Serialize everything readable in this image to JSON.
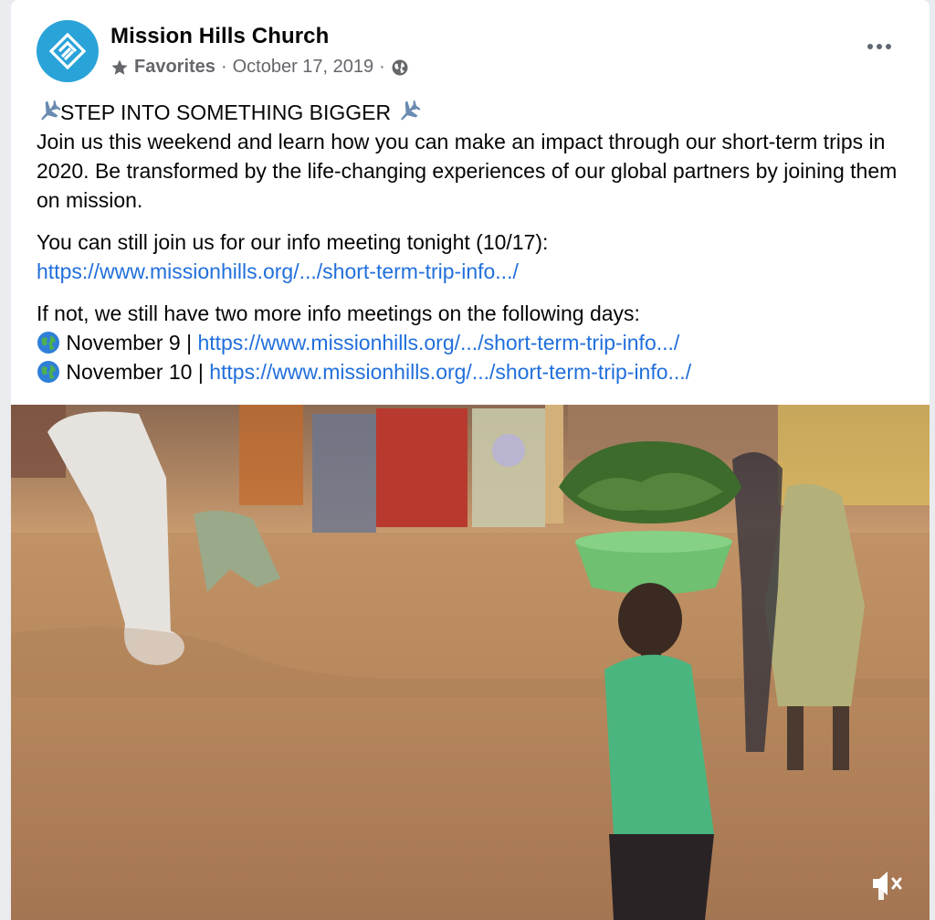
{
  "post": {
    "author": "Mission Hills Church",
    "meta": {
      "star_icon": "star-icon",
      "audience": "Favorites",
      "separator1": "·",
      "date": "October 17, 2019",
      "separator2": "·",
      "privacy_icon": "globe-icon"
    },
    "more_icon": "more-options-icon",
    "headline_icon": "airplane-icon",
    "headline": "STEP INTO SOMETHING BIGGER",
    "paragraph1": "Join us this weekend and learn how you can make an impact through our short-term trips in 2020. Be transformed by the life-changing experiences of our global partners by joining them on mission.",
    "paragraph2": "You can still join us for our info meeting tonight (10/17):",
    "link1": "https://www.missionhills.org/.../short-term-trip-info.../",
    "paragraph3": "If not, we still have two more info meetings on the following days:",
    "meetings": [
      {
        "icon": "globe-emoji-icon",
        "date": "November 9",
        "separator": "|",
        "link": "https://www.missionhills.org/.../short-term-trip-info.../"
      },
      {
        "icon": "globe-emoji-icon",
        "date": "November 10",
        "separator": "|",
        "link": "https://www.missionhills.org/.../short-term-trip-info.../"
      }
    ]
  },
  "video": {
    "description": "",
    "mute_icon": "muted-speaker-icon"
  },
  "colors": {
    "avatar_bg": "#2aa3d9",
    "link": "#216fdb",
    "meta_text": "#65676b"
  }
}
